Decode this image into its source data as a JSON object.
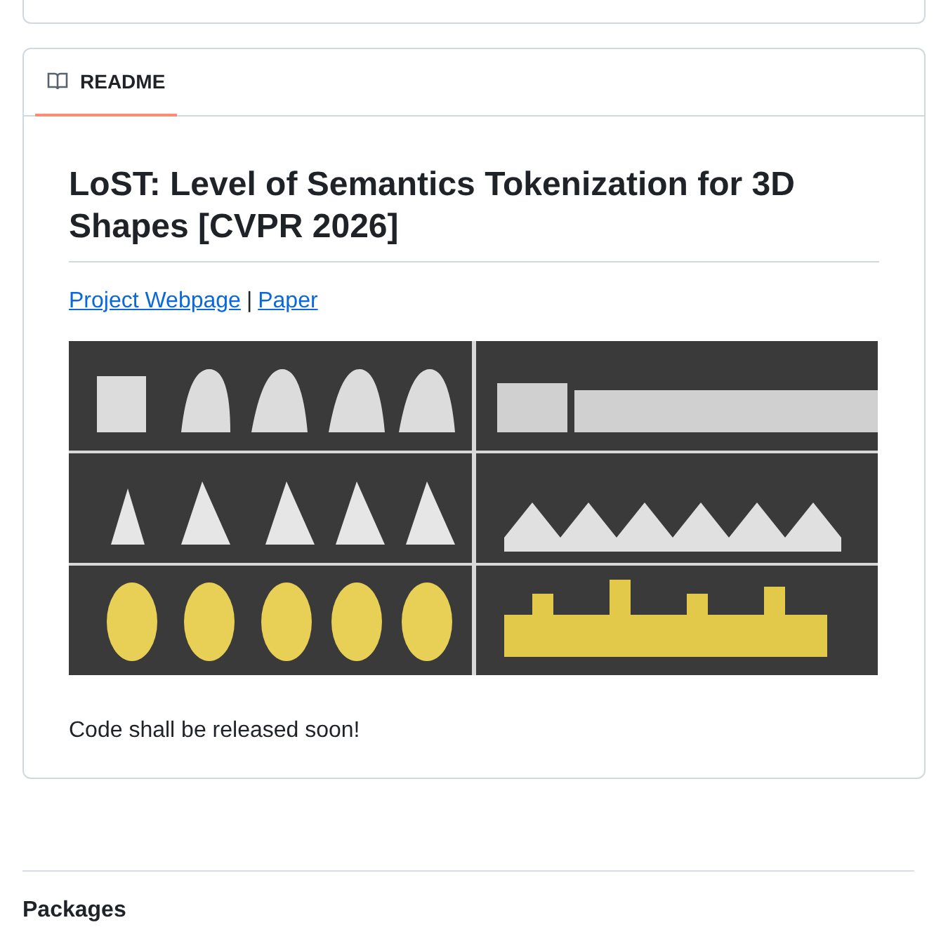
{
  "readme": {
    "tab": {
      "label": "README",
      "selected": true
    },
    "title": "LoST: Level of Semantics Tokenization for 3D Shapes [CVPR 2026]",
    "links": [
      {
        "text": "Project Webpage"
      },
      {
        "text": "Paper"
      }
    ],
    "separator": "|",
    "note": "Code shall be released soon!"
  },
  "packages": {
    "heading": "Packages"
  }
}
